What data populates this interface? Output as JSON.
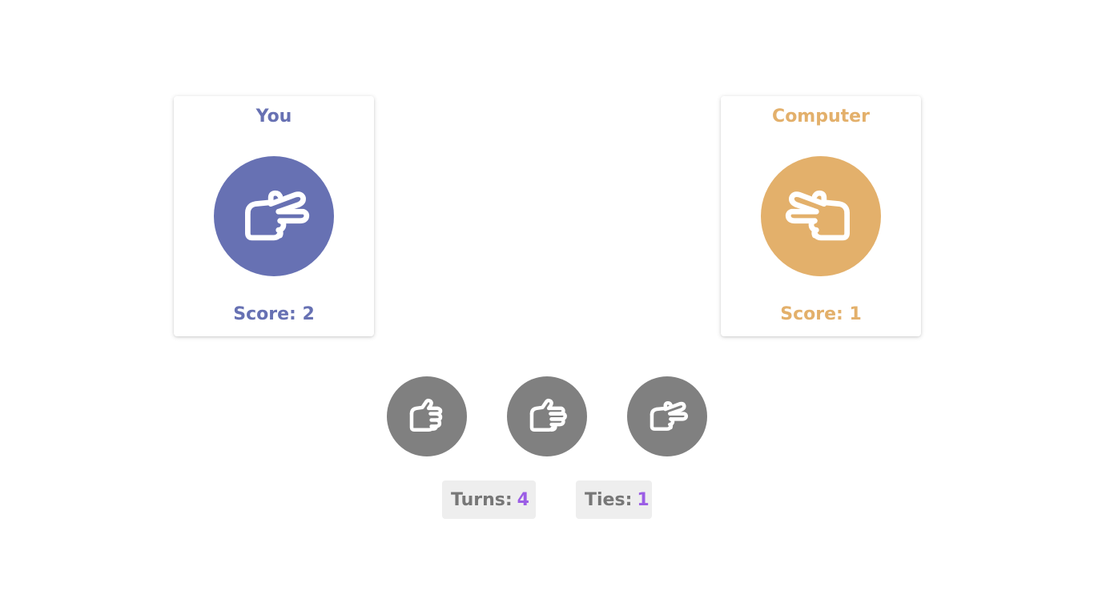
{
  "player": {
    "title": "You",
    "score_label": "Score: 2",
    "hand_icon": "scissors-hand-icon",
    "color": "#6771b3"
  },
  "computer": {
    "title": "Computer",
    "score_label": "Score: 1",
    "hand_icon": "scissors-hand-icon",
    "color": "#e3b06b"
  },
  "choices": [
    {
      "icon": "rock-hand-icon"
    },
    {
      "icon": "paper-hand-icon"
    },
    {
      "icon": "scissors-hand-icon"
    }
  ],
  "choice_color": "#808080",
  "stats": {
    "turns_label": "Turns:",
    "turns_value": "4",
    "ties_label": "Ties:",
    "ties_value": "1",
    "value_color": "#9b5de5"
  }
}
